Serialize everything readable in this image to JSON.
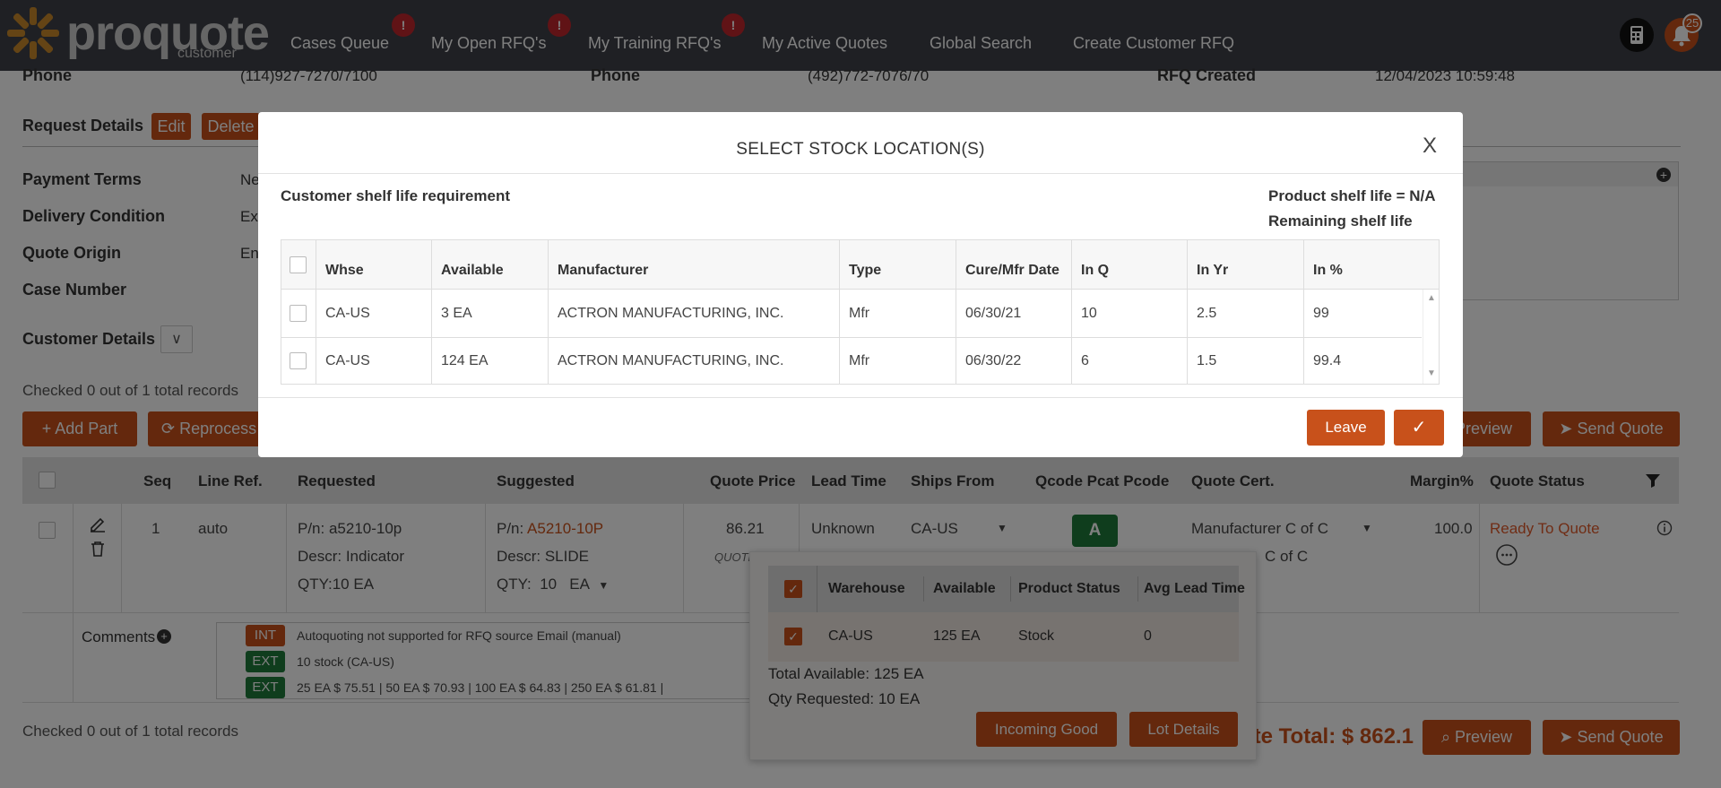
{
  "nav": {
    "logo_text": "proquote",
    "logo_sub": "customer",
    "links": [
      "Cases Queue",
      "My Open RFQ's",
      "My Training RFQ's",
      "My Active Quotes",
      "Global Search",
      "Create Customer RFQ"
    ],
    "badge_glyph": "!",
    "notification_count": "25"
  },
  "contact": {
    "phone_label": "Phone",
    "phone1": "(114)927-7270/7100",
    "phone2": "(492)772-7076/70",
    "rfq_created_label": "RFQ Created",
    "rfq_created": "12/04/2023 10:59:48"
  },
  "request": {
    "title": "Request Details",
    "edit": "Edit",
    "delete": "Delete",
    "labels": [
      "Payment Terms",
      "Delivery Condition",
      "Quote Origin",
      "Case Number"
    ],
    "values": [
      "Ne",
      "Ex",
      "En",
      ""
    ]
  },
  "customer_details": {
    "title": "Customer Details",
    "toggle": "∨"
  },
  "records": {
    "checked_top": "Checked 0 out of 1 total records",
    "checked_bottom": "Checked 0 out of 1 total records"
  },
  "toolbar": {
    "add_part": "Add Part",
    "reprocess": "Reprocess",
    "preview": "Preview",
    "send_quote": "Send Quote"
  },
  "grid": {
    "headers": [
      "Seq",
      "Line Ref.",
      "Requested",
      "Suggested",
      "Quote Price",
      "Lead Time",
      "Ships From",
      "Qcode Pcat Pcode",
      "Quote Cert.",
      "Margin%",
      "Quote Status"
    ],
    "row": {
      "seq": "1",
      "line_ref": "auto",
      "req_pn": "P/n: a5210-10p",
      "req_descr": "Descr: Indicator",
      "req_qty": "QTY:10 EA",
      "sug_pn_label": "P/n:",
      "sug_pn": "A5210-10P",
      "sug_descr": "Descr: SLIDE",
      "sug_qty_label": "QTY:",
      "sug_qty": "10",
      "sug_uom": "EA",
      "quote_price": "86.21",
      "quote_sub": "QUOTE",
      "lead_time": "Unknown",
      "ships_from": "CA-US",
      "qcode": "A",
      "cert": "Manufacturer C of C",
      "cert2": "C of C",
      "margin": "100.0",
      "status": "Ready To Quote"
    },
    "comments_label": "Comments",
    "comments": [
      {
        "tag": "INT",
        "text": "Autoquoting not supported for RFQ source Email (manual)",
        "color": "#c8511b"
      },
      {
        "tag": "EXT",
        "text": "10 stock (CA-US)",
        "color": "#1e7a3a"
      },
      {
        "tag": "EXT",
        "text": "25 EA $ 75.51 | 50 EA $ 70.93 | 100 EA $ 64.83 | 250 EA $ 61.81 |",
        "color": "#1e7a3a"
      }
    ]
  },
  "footer": {
    "quote_total": "ote Total: $ 862.1"
  },
  "popup": {
    "headers": [
      "Warehouse",
      "Available",
      "Product Status",
      "Avg Lead Time"
    ],
    "row": [
      "CA-US",
      "125 EA",
      "Stock",
      "0"
    ],
    "total_available": "Total Available: 125 EA",
    "qty_requested": "Qty Requested: 10 EA",
    "incoming_good": "Incoming Good",
    "lot_details": "Lot Details"
  },
  "modal": {
    "title": "SELECT STOCK LOCATION(S)",
    "close": "X",
    "customer_shelf": "Customer shelf life requirement",
    "product_shelf": "Product shelf life = N/A",
    "remaining_shelf": "Remaining shelf life",
    "headers": [
      "Whse",
      "Available",
      "Manufacturer",
      "Type",
      "Cure/Mfr Date",
      "In Q",
      "In Yr",
      "In %"
    ],
    "rows": [
      [
        "CA-US",
        "3 EA",
        "ACTRON MANUFACTURING, INC.",
        "Mfr",
        "06/30/21",
        "10",
        "2.5",
        "99"
      ],
      [
        "CA-US",
        "124 EA",
        "ACTRON MANUFACTURING, INC.",
        "Mfr",
        "06/30/22",
        "6",
        "1.5",
        "99.4"
      ]
    ],
    "leave": "Leave",
    "confirm": "✓"
  },
  "colors": {
    "accent": "#c8511b",
    "nav_bg": "#3e4048",
    "green": "#1e7a3a",
    "status": "#e05a2a"
  }
}
